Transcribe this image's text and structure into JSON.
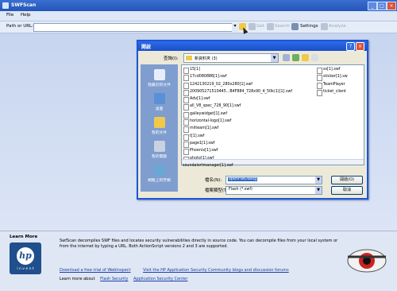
{
  "app": {
    "title": "SWFScan"
  },
  "menu": {
    "file": "File",
    "help": "Help"
  },
  "toolbar": {
    "path_label": "Path or URL:",
    "path_value": "",
    "buttons": {
      "get": "Get",
      "search": "Search",
      "settings": "Settings",
      "analyze": "Analyze"
    }
  },
  "dialog": {
    "title": "開啟",
    "look_in_label": "查詢(I):",
    "look_in_value": "新資料夾 (3)",
    "places": [
      "我最近的文件",
      "桌面",
      "我的文件",
      "我的電腦",
      "網路上的芳鄰"
    ],
    "files_col1": [
      "15[1]",
      "17cd080886[1].swf",
      "1242130219_02_280x280[1].swf",
      "200905271510445...B4F884_728x90_4_50k(1)[1].swf",
      "Adv[1].swf",
      "all_V8_spec_728_90[1].swf",
      "galleywidget[1].swf",
      "horizontal-logo[1].swf",
      "milteam[1].swf",
      "t[1].swf",
      "page1[1].swf",
      "Phoenix[1].swf",
      "photo[1].swf",
      "soundalertmanager[1].swf"
    ],
    "files_col2": [
      "ss[1].swf",
      "sticker[1].sw",
      "TeamPlayer",
      "ticket_client"
    ],
    "filename_label": "檔名(N):",
    "filename_value": "openFileDialog",
    "filetype_label": "檔案類型(T):",
    "filetype_value": "Flash (*.swf)",
    "open_button": "開啟(O)",
    "cancel_button": "取消"
  },
  "bottom": {
    "learn_more_title": "Learn More",
    "hp_logo": "hp",
    "hp_tagline": "i n v e n t",
    "description": "SwfScan decompiles SWF files and locates security vulnerabilities directly in source code. You can decompile files from your local system or from the internet by typing a URL. Both ActionScript versions 2 and 3 are supported.",
    "link_trial": "Download a free trial of WebInspect",
    "link_community": "Visit the HP Application Security Community blogs and discussion forums",
    "learn_more_about": "Learn more about",
    "link_flash": "Flash Security",
    "link_center": "Application Security Center"
  }
}
